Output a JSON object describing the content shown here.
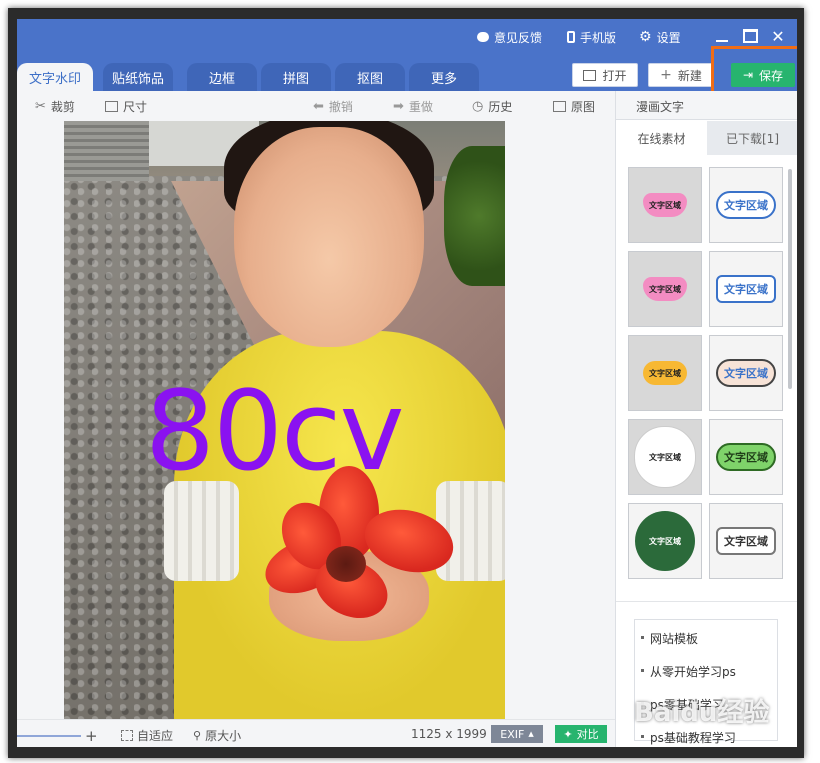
{
  "titlebar": {
    "feedback": "意见反馈",
    "mobile": "手机版",
    "settings": "设置"
  },
  "tabs": [
    {
      "label": "文字水印",
      "active": true
    },
    {
      "label": "贴纸饰品"
    },
    {
      "label": "边框"
    },
    {
      "label": "拼图"
    },
    {
      "label": "抠图"
    },
    {
      "label": "更多"
    }
  ],
  "actions": {
    "open": "打开",
    "new": "新建",
    "save": "保存"
  },
  "toolbar": {
    "crop": "裁剪",
    "size": "尺寸",
    "undo": "撤销",
    "redo": "重做",
    "history": "历史",
    "original": "原图"
  },
  "canvas": {
    "watermark_text": "80cv"
  },
  "statusbar": {
    "fit": "自适应",
    "actual_size": "原大小",
    "dimensions": "1125 x 1999",
    "exif": "EXIF",
    "compare": "对比"
  },
  "panel": {
    "category": "漫画文字",
    "tab_online": "在线素材",
    "tab_downloaded": "已下载[1]",
    "tile_text": "文字区域",
    "links": [
      "网站模板",
      "从零开始学习ps",
      "ps零基础学习",
      "ps基础教程学习"
    ]
  },
  "overlay": {
    "watermark": "Baidu经验"
  },
  "colors": {
    "titlebar": "#4a73c9",
    "accent": "#3d6fc7",
    "save_green": "#27b46e",
    "highlight": "#f06d16",
    "watermark_purple": "#8a12f0"
  }
}
